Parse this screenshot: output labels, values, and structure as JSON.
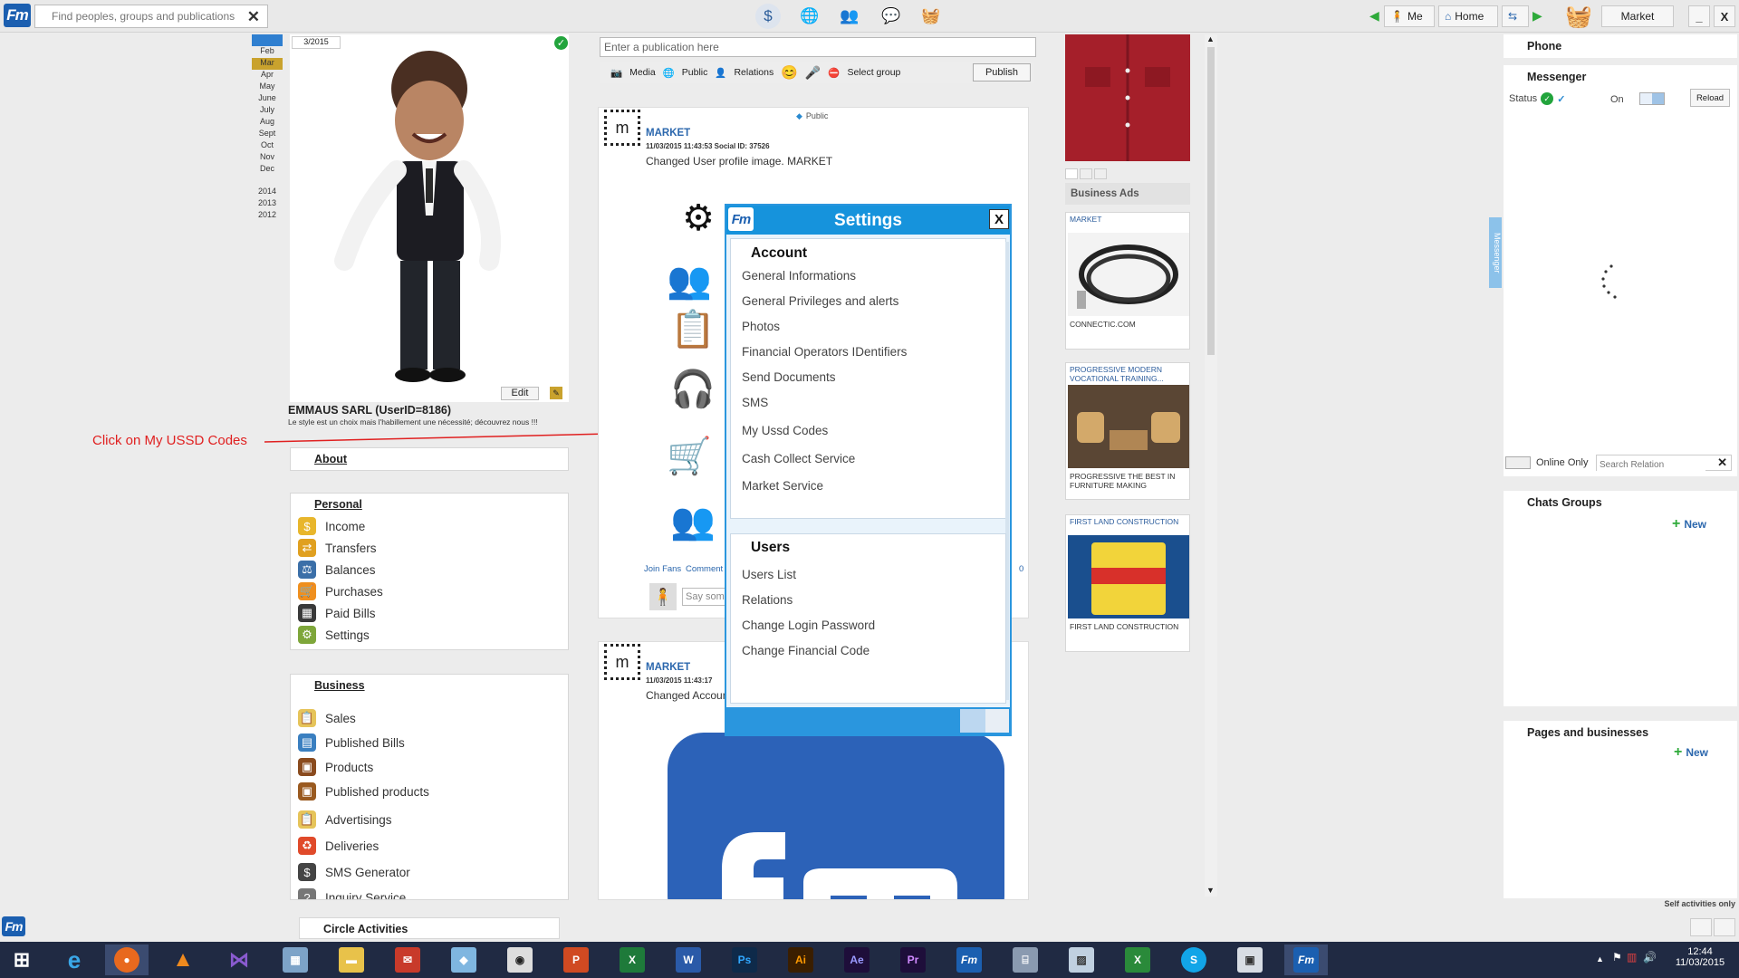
{
  "topbar": {
    "search_placeholder": "Find peoples, groups and publications",
    "clear": "✕",
    "me_label": "Me",
    "home_label": "Home",
    "market_label": "Market",
    "minimize": "_",
    "close": "X"
  },
  "calendar": {
    "year_selected": "2015",
    "months": [
      "Feb",
      "Mar",
      "Apr",
      "May",
      "June",
      "July",
      "Aug",
      "Sept",
      "Oct",
      "Nov",
      "Dec"
    ],
    "years": [
      "2014",
      "2013",
      "2012"
    ]
  },
  "profile": {
    "date": "3/2015",
    "edit_label": "Edit",
    "username": "EMMAUS SARL (UserID=8186)",
    "slogan": "Le style est un choix mais l'habillement une nécessité; découvrez nous !!!"
  },
  "annotation": {
    "text": "Click on My USSD Codes"
  },
  "about": {
    "label": "About"
  },
  "personal": {
    "title": "Personal",
    "items": [
      "Income",
      "Transfers",
      "Balances",
      "Purchases",
      "Paid Bills",
      "Settings"
    ]
  },
  "business": {
    "title": "Business",
    "items": [
      "Sales",
      "Published Bills",
      "Products",
      "Published products",
      "Advertisings",
      "Deliveries",
      "SMS Generator",
      "Inquiry Service"
    ]
  },
  "circle": {
    "label": "Circle Activities"
  },
  "composer": {
    "placeholder": "Enter a publication here",
    "media": "Media",
    "public": "Public",
    "relations": "Relations",
    "select_group": "Select group",
    "publish": "Publish"
  },
  "post1": {
    "visibility": "Public",
    "author": "MARKET",
    "meta": "11/03/2015 11:43:53   Social ID: 37526",
    "text": "Changed User profile image. MARKET",
    "join_fans": "Join Fans",
    "comment": "Comment",
    "count": "0",
    "say_placeholder": "Say som"
  },
  "post2": {
    "author": "MARKET",
    "meta": "11/03/2015 11:43:17",
    "text": "Changed Accoun"
  },
  "settings": {
    "title": "Settings",
    "close": "X",
    "account_title": "Account",
    "account_items": [
      "General Informations",
      "General Privileges and alerts",
      "Photos",
      "Financial Operators IDentifiers",
      "Send Documents",
      "SMS",
      "My Ussd Codes",
      "Cash Collect Service",
      "Market Service"
    ],
    "users_title": "Users",
    "users_items": [
      "Users List",
      "Relations",
      "Change Login Password",
      "Change Financial Code"
    ]
  },
  "ads": {
    "business_ads_label": "Business Ads",
    "ad1_title": "MARKET",
    "ad1_sub": "CONNECTIC.COM",
    "ad2_title": "PROGRESSIVE MODERN VOCATIONAL TRAINING...",
    "ad2_sub": "PROGRESSIVE THE BEST IN FURNITURE MAKING",
    "ad3_title": "FIRST LAND CONSTRUCTION",
    "ad3_sub": "FIRST LAND CONSTRUCTION"
  },
  "right": {
    "phone": "Phone",
    "messenger": "Messenger",
    "status": "Status",
    "on": "On",
    "reload": "Reload",
    "side_tab": "Messenger",
    "online_only": "Online Only",
    "search_relation_placeholder": "Search Relation",
    "chats_groups": "Chats Groups",
    "pages_businesses": "Pages and businesses",
    "new": "New",
    "self_activities": "Self activities only"
  },
  "clock": {
    "time": "12:44",
    "date": "11/03/2015"
  },
  "colors": {
    "accent": "#1693dc",
    "annotation": "#e02020",
    "taskbar": "#202a43"
  }
}
